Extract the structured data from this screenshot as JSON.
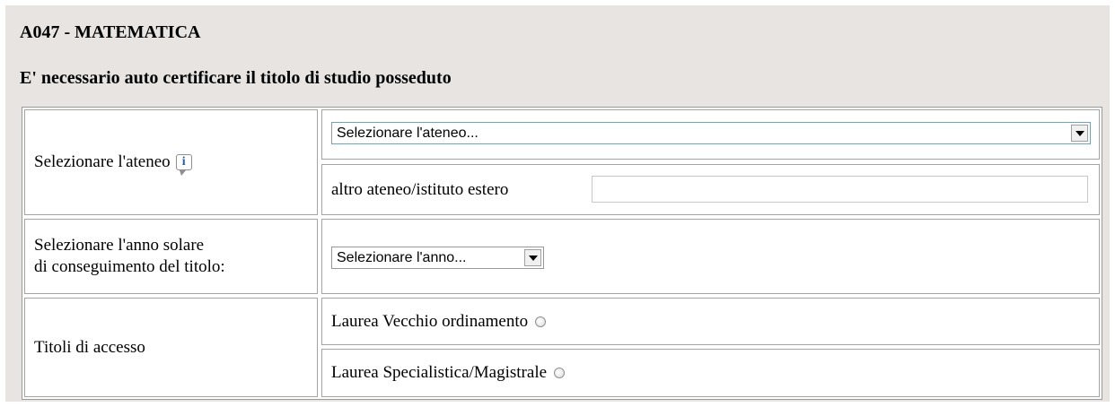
{
  "heading": {
    "code": "A047 - MATEMATICA",
    "subtitle": "E' necessario auto certificare il titolo di studio posseduto"
  },
  "form": {
    "ateneo": {
      "label": "Selezionare l'ateneo",
      "info_icon": "i",
      "select_value": "Selezionare l'ateneo...",
      "altro_label": "altro ateneo/istituto estero",
      "altro_value": ""
    },
    "anno": {
      "label_line1": "Selezionare l'anno solare",
      "label_line2": "di conseguimento del titolo:",
      "select_value": "Selezionare l'anno..."
    },
    "titoli": {
      "label": "Titoli di accesso",
      "options": [
        {
          "label": "Laurea Vecchio ordinamento",
          "checked": false
        },
        {
          "label": "Laurea Specialistica/Magistrale",
          "checked": false
        }
      ]
    }
  },
  "icons": {
    "info": "info-speech-bubble-icon",
    "dropdown": "chevron-down-icon",
    "radio": "radio-unchecked-icon"
  },
  "colors": {
    "panel_background": "#e7e4e1",
    "border": "#a4a4a4",
    "info_icon_text": "#2b5aa6"
  }
}
